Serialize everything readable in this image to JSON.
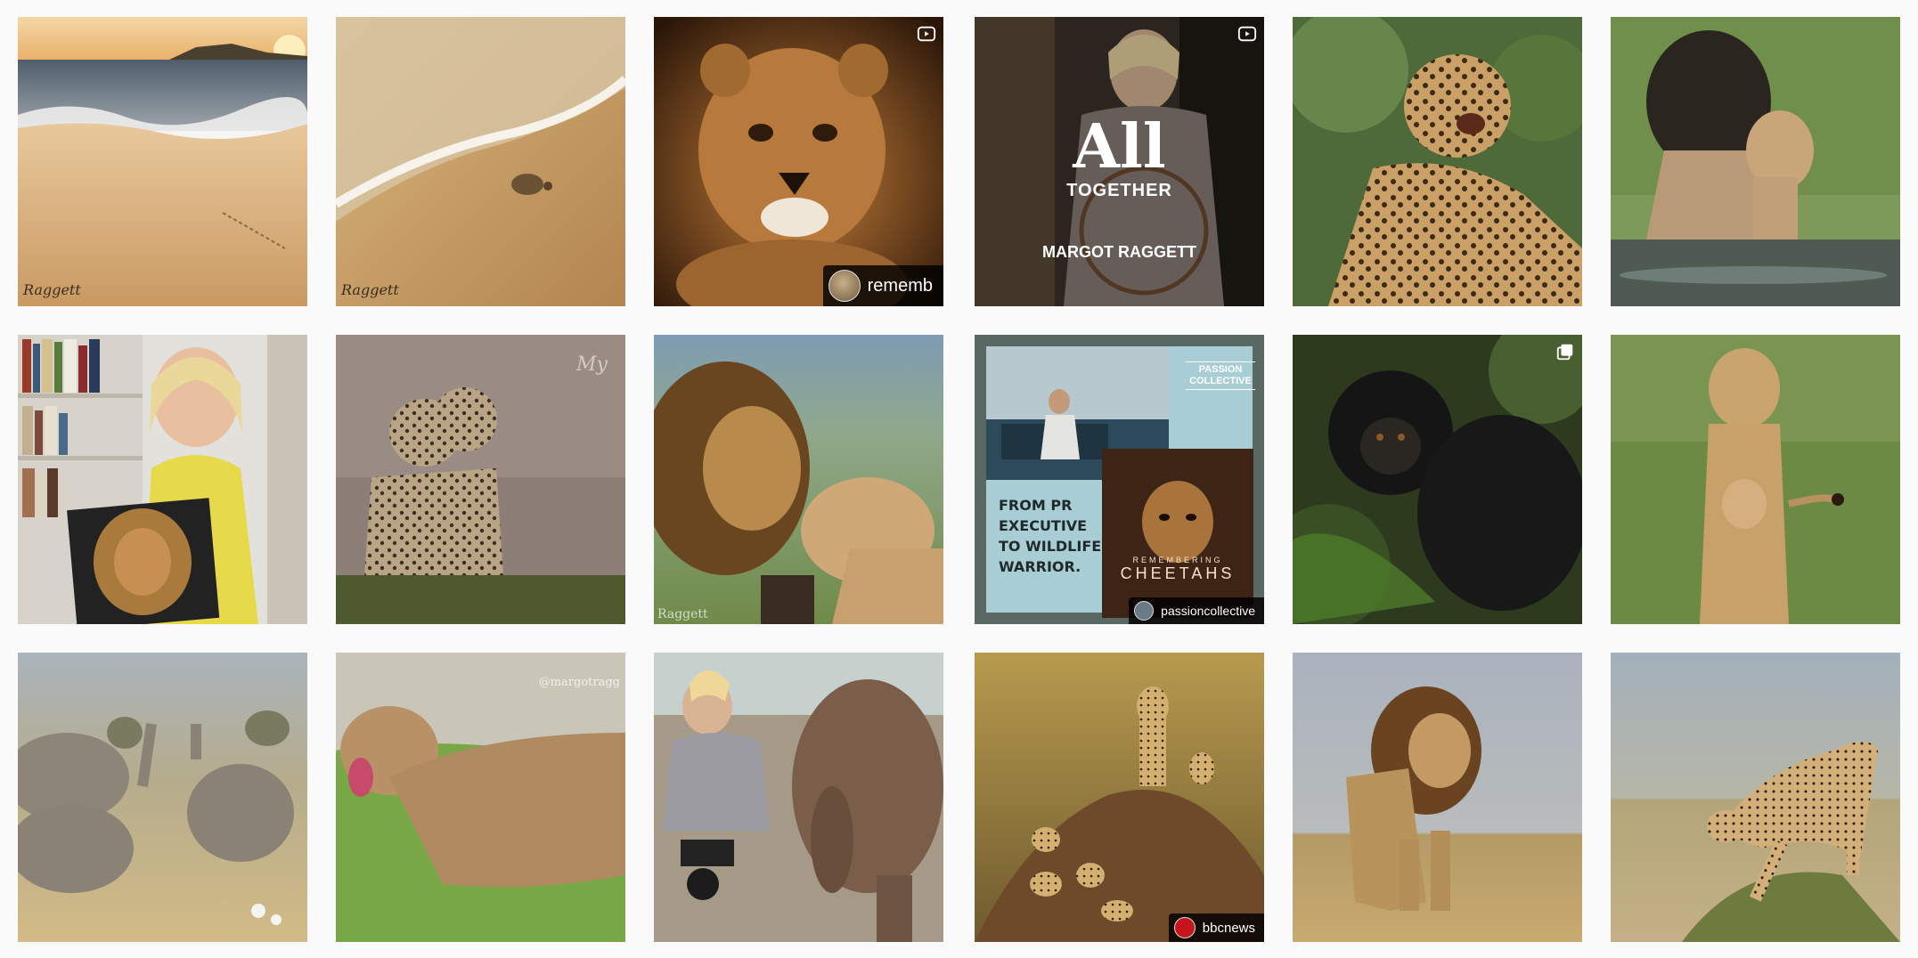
{
  "tiles": [
    {
      "type": "image",
      "subject": "beach sunset with turtle tracks"
    },
    {
      "type": "image",
      "subject": "baby sea turtle on sand"
    },
    {
      "type": "reel",
      "subject": "cheetah cub portrait",
      "badge": "rememb"
    },
    {
      "type": "reel",
      "subject": "woman on safari vehicle",
      "overlay_title": "All",
      "overlay_subtitle": "TOGETHER",
      "overlay_name": "MARGOT RAGGETT"
    },
    {
      "type": "image",
      "subject": "leopard looking up"
    },
    {
      "type": "image",
      "subject": "lion and cub at water"
    },
    {
      "type": "image",
      "subject": "woman holding lion book"
    },
    {
      "type": "image",
      "subject": "cheetah cubs"
    },
    {
      "type": "image",
      "subject": "lion and lioness"
    },
    {
      "type": "image",
      "subject": "passion collective feature",
      "brand_line1": "PASSION",
      "brand_line2": "COLLECTIVE",
      "headline": [
        "FROM PR",
        "EXECUTIVE",
        "TO WILDLIFE",
        "WARRIOR."
      ],
      "book_title_top": "REMEMBERING",
      "book_title": "CHEETAHS",
      "badge": "passioncollective"
    },
    {
      "type": "carousel",
      "subject": "baby gorilla"
    },
    {
      "type": "image",
      "subject": "lioness with cub"
    },
    {
      "type": "image",
      "subject": "elephants trumpeting"
    },
    {
      "type": "image",
      "subject": "lioness yawning",
      "watermark": "@margotragg"
    },
    {
      "type": "image",
      "subject": "woman with baby elephant"
    },
    {
      "type": "image",
      "subject": "cheetah family on termite mound",
      "badge": "bbcnews"
    },
    {
      "type": "image",
      "subject": "lion walking in savanna"
    },
    {
      "type": "image",
      "subject": "cheetah stretching"
    }
  ],
  "icons": {
    "reel": "reel-icon",
    "carousel": "carousel-icon"
  }
}
